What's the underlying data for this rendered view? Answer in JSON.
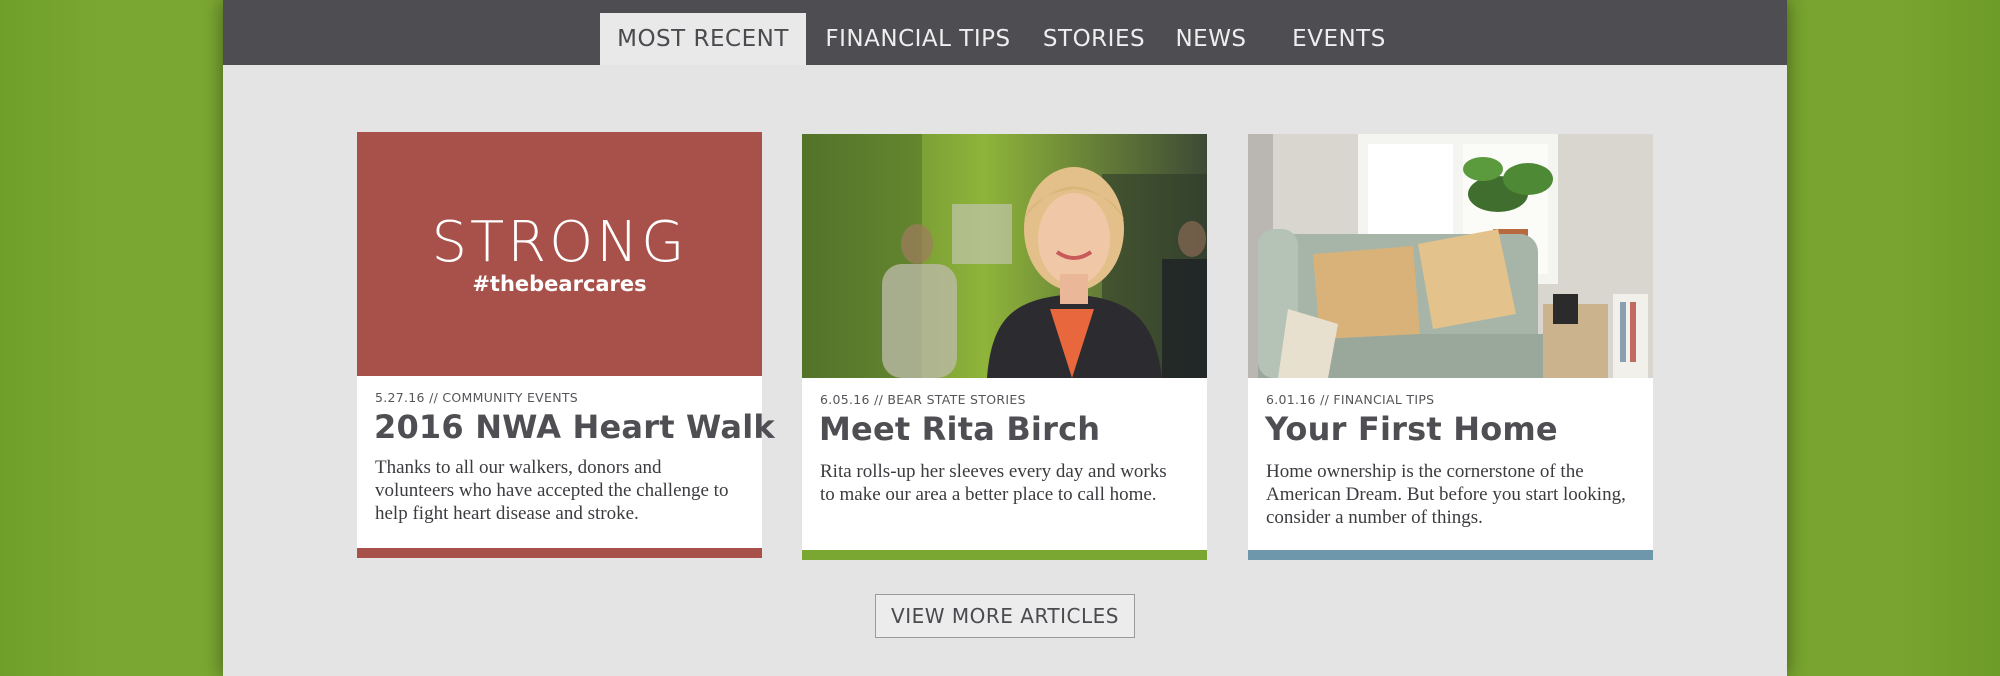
{
  "nav": {
    "tabs": [
      {
        "label": "MOST RECENT",
        "active": true
      },
      {
        "label": "FINANCIAL TIPS",
        "active": false
      },
      {
        "label": "STORIES",
        "active": false
      },
      {
        "label": "NEWS",
        "active": false
      },
      {
        "label": "EVENTS",
        "active": false
      }
    ]
  },
  "cards": [
    {
      "image": {
        "logo_word": "STRONG",
        "hashtag": "#thebearcares",
        "background": "#a8514a"
      },
      "meta": "5.27.16 // COMMUNITY EVENTS",
      "title": "2016 NWA Heart Walk",
      "excerpt": "Thanks to all our walkers, donors and volunteers who have accepted the challenge to help fight heart disease and stroke.",
      "accent": "#a8514a"
    },
    {
      "image": {
        "description_icon": "portrait-photo"
      },
      "meta": "6.05.16 // BEAR STATE STORIES",
      "title": "Meet Rita Birch",
      "excerpt": "Rita rolls-up her sleeves every day and works to make our area a better place to call home.",
      "accent": "#7aa632"
    },
    {
      "image": {
        "description_icon": "living-room-photo"
      },
      "meta": "6.01.16 // FINANCIAL TIPS",
      "title": "Your First Home",
      "excerpt": "Home ownership is the cornerstone of the American Dream. But before you start looking, consider a number of things.",
      "accent": "#6f97ab"
    }
  ],
  "view_more_label": "VIEW MORE ARTICLES",
  "colors": {
    "nav_bg": "#4d4d52",
    "page_bg": "#e4e4e4",
    "side_bg": "#78a42f"
  }
}
